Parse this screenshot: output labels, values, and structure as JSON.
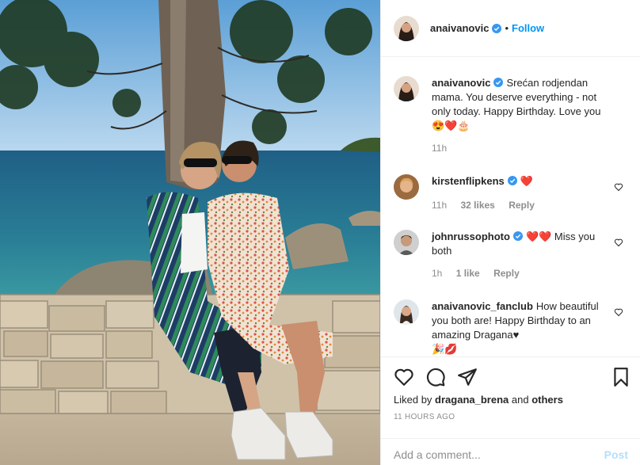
{
  "post": {
    "author": "anaivanovic",
    "follow_label": "Follow",
    "dot": "•",
    "photo_alt": "photo"
  },
  "comments": [
    {
      "user": "anaivanovic",
      "text": "Srećan rodjendan mama. You deserve everything - not only today. Happy Birthday. Love you",
      "emoji": "😍❤️🎂",
      "time": "11h"
    },
    {
      "user": "kirstenflipkens",
      "text": "",
      "emoji": "❤️",
      "time": "11h",
      "likes": "32 likes",
      "reply": "Reply"
    },
    {
      "user": "johnrussophoto",
      "text": "❤️❤️ Miss you both",
      "time": "1h",
      "likes": "1 like",
      "reply": "Reply"
    },
    {
      "user": "anaivanovic_fanclub",
      "text": "How beautiful you both are! Happy Birthday to an amazing Dragana♥",
      "emoji": "🎉💋"
    }
  ],
  "likes": {
    "prefix": "Liked by",
    "user": "dragana_brena",
    "and": "and",
    "others": "others"
  },
  "timestamp": "11 HOURS AGO",
  "add_comment": {
    "placeholder": "Add a comment...",
    "post_label": "Post"
  },
  "colors": {
    "link_blue": "#0095f6",
    "verified_blue": "#3897f0",
    "like_red": "#ed4956",
    "muted": "#8e8e8e"
  },
  "icons": {
    "like": "heart-icon",
    "comment": "comment-icon",
    "share": "share-icon",
    "save": "bookmark-icon",
    "verified": "verified-badge-icon"
  }
}
